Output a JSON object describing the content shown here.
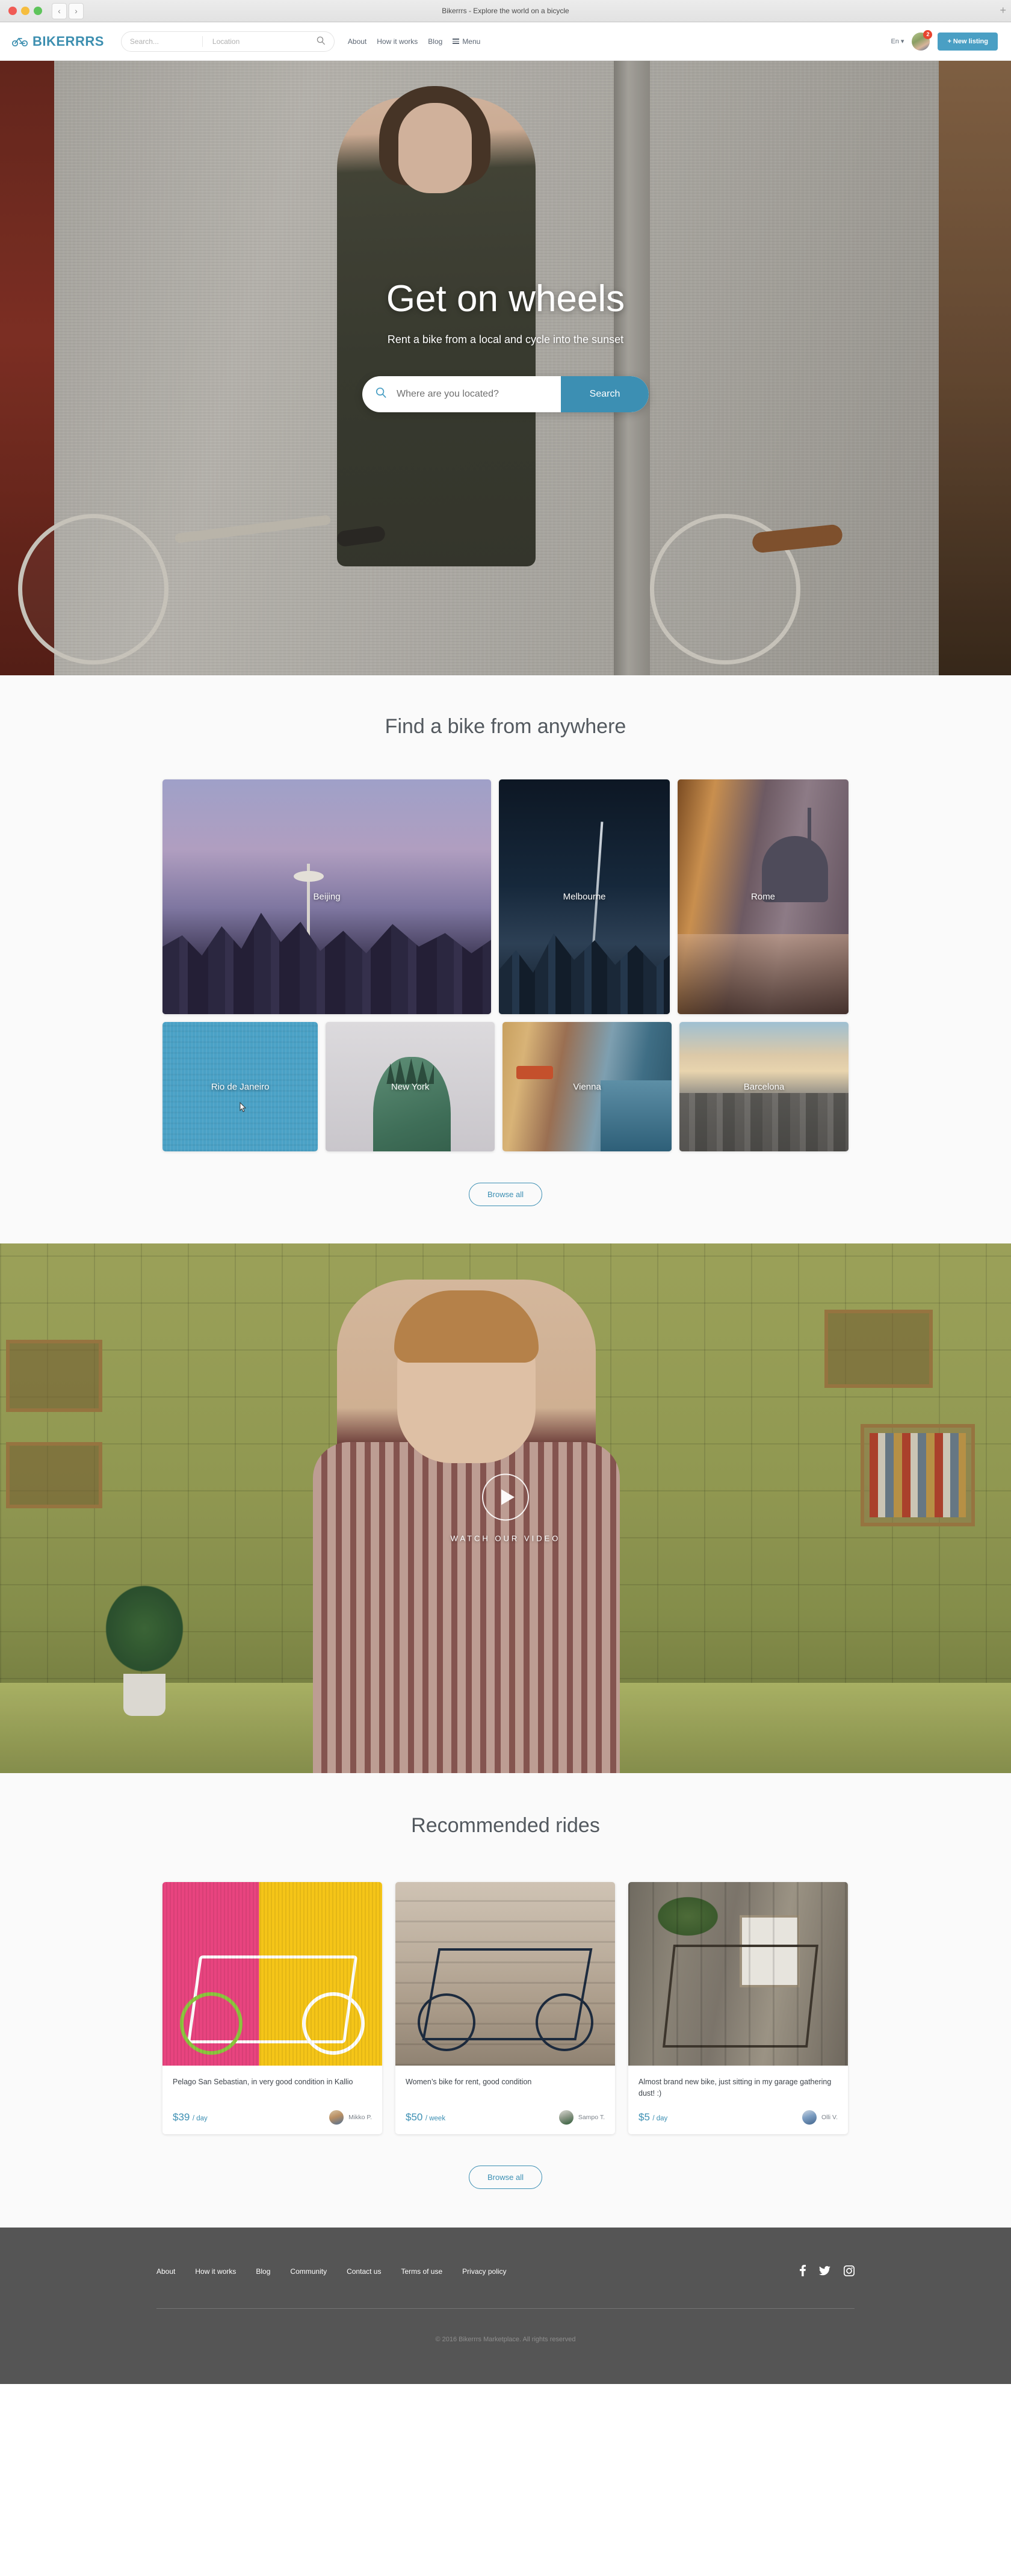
{
  "browser": {
    "title": "Bikerrrs - Explore the world on a bicycle",
    "back_icon": "chevron-left-icon",
    "forward_icon": "chevron-right-icon",
    "new_tab_label": "+"
  },
  "header": {
    "logo_text": "BIKERRRS",
    "logo_icon": "bicycle-icon",
    "search_placeholder": "Search...",
    "location_placeholder": "Location",
    "search_icon": "search-icon",
    "nav": [
      {
        "label": "About"
      },
      {
        "label": "How it works"
      },
      {
        "label": "Blog"
      }
    ],
    "menu_label": "Menu",
    "menu_icon": "hamburger-icon",
    "language": "En",
    "language_caret": "▾",
    "notification_count": "2",
    "new_listing_label": "+ New listing",
    "accent_color": "#4a9fc4"
  },
  "hero": {
    "title": "Get on wheels",
    "subtitle": "Rent a bike from a local and cycle into the sunset",
    "search_placeholder": "Where are you located?",
    "search_icon": "search-icon",
    "search_button": "Search"
  },
  "cities": {
    "title": "Find a bike from anywhere",
    "row1": [
      {
        "name": "Beijing"
      },
      {
        "name": "Melbourne"
      },
      {
        "name": "Rome"
      }
    ],
    "row2": [
      {
        "name": "Rio de Janeiro"
      },
      {
        "name": "New York"
      },
      {
        "name": "Vienna"
      },
      {
        "name": "Barcelona"
      }
    ],
    "browse_label": "Browse all"
  },
  "video": {
    "play_icon": "play-icon",
    "label": "WATCH OUR VIDEO"
  },
  "rides": {
    "title": "Recommended rides",
    "items": [
      {
        "title": "Pelago San Sebastian, in very good condition in Kallio",
        "price": "$39",
        "period": "/ day",
        "owner": "Mikko P."
      },
      {
        "title": "Women’s bike for rent, good condition",
        "price": "$50",
        "period": "/ week",
        "owner": "Sampo T."
      },
      {
        "title": "Almost brand new bike, just sitting in my garage gathering dust! :)",
        "price": "$5",
        "period": "/ day",
        "owner": "Olli V."
      }
    ],
    "browse_label": "Browse all"
  },
  "footer": {
    "links": [
      {
        "label": "About"
      },
      {
        "label": "How it works"
      },
      {
        "label": "Blog"
      },
      {
        "label": "Community"
      },
      {
        "label": "Contact us"
      },
      {
        "label": "Terms of use"
      },
      {
        "label": "Privacy policy"
      }
    ],
    "social": [
      {
        "icon": "facebook-icon",
        "glyph": "f"
      },
      {
        "icon": "twitter-icon",
        "glyph": "ᵛ"
      },
      {
        "icon": "instagram-icon",
        "glyph": "▣"
      }
    ],
    "copyright": "© 2016 Bikerrrs Marketplace. All rights reserved"
  }
}
